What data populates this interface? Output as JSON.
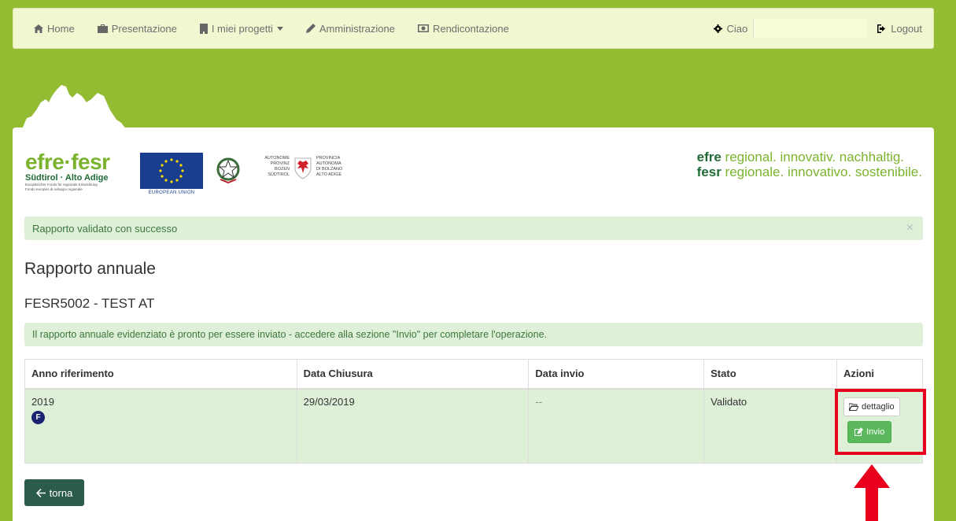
{
  "nav": {
    "home": "Home",
    "presentazione": "Presentazione",
    "progetti": "I miei progetti",
    "amministrazione": "Amministrazione",
    "rendicontazione": "Rendicontazione",
    "ciao": "Ciao",
    "logout": "Logout"
  },
  "logos": {
    "efre_big": "efre·fesr",
    "efre_sub": "Südtirol · Alto Adige",
    "efre_tiny1": "Europäischer Fonds für regionale Entwicklung",
    "efre_tiny2": "Fondo europeo di sviluppo regionale",
    "eu_label": "EUROPEAN UNION",
    "prov_left": [
      "AUTONOME",
      "PROVINZ",
      "BOZEN",
      "SÜDTIROL"
    ],
    "prov_right": [
      "PROVINCIA",
      "AUTONOMA",
      "DI BOLZANO",
      "ALTO ADIGE"
    ],
    "slogan_de_bold": "efre",
    "slogan_de": " regional. innovativ. nachhaltig.",
    "slogan_it_bold": "fesr",
    "slogan_it": " regionale. innovativo. sostenibile."
  },
  "alert_success": "Rapporto validato con successo",
  "alert_close": "×",
  "page_title": "Rapporto annuale",
  "project_title": "FESR5002 - TEST AT",
  "alert_info": "Il rapporto annuale evidenziato è pronto per essere inviato - accedere alla sezione \"Invio\" per completare l'operazione.",
  "table": {
    "headers": [
      "Anno riferimento",
      "Data Chiusura",
      "Data invio",
      "Stato",
      "Azioni"
    ],
    "rows": [
      {
        "anno": "2019",
        "badge": "F",
        "chiusura": "29/03/2019",
        "invio": "--",
        "stato": "Validato",
        "btn_dettaglio": "dettaglio",
        "btn_invio": "Invio"
      }
    ]
  },
  "back_button": "torna",
  "colors": {
    "page_bg": "#94bc32",
    "success_bg": "#dff0d8",
    "success_text": "#3c763d",
    "btn_green": "#5cb85c",
    "btn_dark": "#2b5b49",
    "highlight": "#e8001c"
  }
}
